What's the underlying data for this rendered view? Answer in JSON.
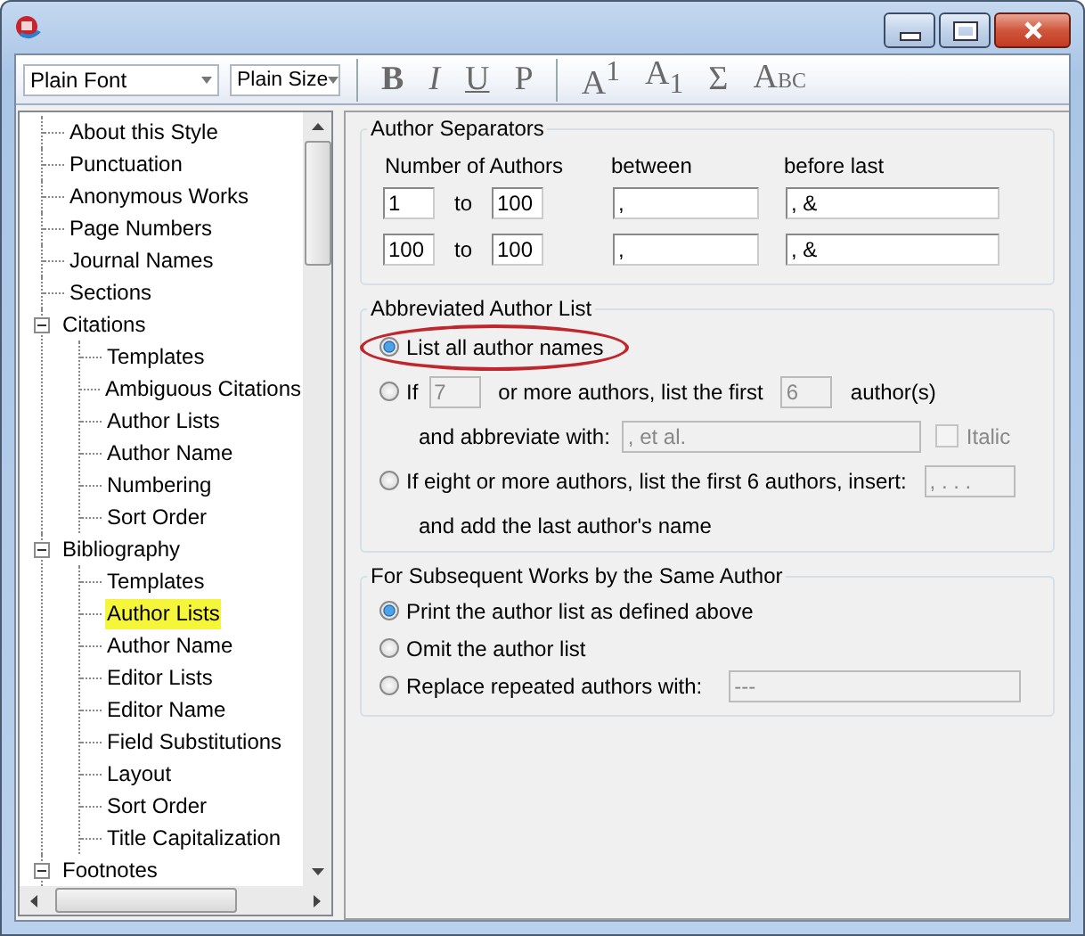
{
  "toolbar": {
    "font_select": "Plain Font",
    "size_select": "Plain Size",
    "format_buttons": [
      {
        "kind": "bold",
        "label": "B"
      },
      {
        "kind": "italic",
        "label": "I"
      },
      {
        "kind": "underline",
        "label": "U"
      },
      {
        "kind": "plain",
        "label": "P"
      }
    ],
    "script_buttons": [
      {
        "kind": "rich",
        "label": "A$^{1}$"
      },
      {
        "kind": "rich",
        "label": "A$_{1}$"
      },
      {
        "kind": "plain",
        "label": "Σ"
      },
      {
        "kind": "smallcaps",
        "label": "A",
        "small": "BC"
      }
    ]
  },
  "tree": [
    {
      "label": "About this Style",
      "selected": false
    },
    {
      "label": "Punctuation",
      "selected": false
    },
    {
      "label": "Anonymous Works",
      "selected": false
    },
    {
      "label": "Page Numbers",
      "selected": false
    },
    {
      "label": "Journal Names",
      "selected": false
    },
    {
      "label": "Sections",
      "selected": false
    },
    {
      "label": "Citations",
      "selected": false,
      "expanded": true,
      "children": [
        {
          "label": "Templates",
          "selected": false
        },
        {
          "label": "Ambiguous Citations",
          "selected": false
        },
        {
          "label": "Author Lists",
          "selected": false
        },
        {
          "label": "Author Name",
          "selected": false
        },
        {
          "label": "Numbering",
          "selected": false
        },
        {
          "label": "Sort Order",
          "selected": false
        }
      ]
    },
    {
      "label": "Bibliography",
      "selected": false,
      "expanded": true,
      "children": [
        {
          "label": "Templates",
          "selected": false
        },
        {
          "label": "Author Lists",
          "selected": true
        },
        {
          "label": "Author Name",
          "selected": false
        },
        {
          "label": "Editor Lists",
          "selected": false
        },
        {
          "label": "Editor Name",
          "selected": false
        },
        {
          "label": "Field Substitutions",
          "selected": false
        },
        {
          "label": "Layout",
          "selected": false
        },
        {
          "label": "Sort Order",
          "selected": false
        },
        {
          "label": "Title Capitalization",
          "selected": false
        }
      ]
    },
    {
      "label": "Footnotes",
      "selected": false,
      "expanded": true
    }
  ],
  "author_separators": {
    "title": "Author Separators",
    "columns": [
      "Number of Authors",
      "between",
      "before last"
    ],
    "rows": [
      {
        "from": "1",
        "to_label": "to",
        "to": "100",
        "between": ",",
        "before_last": ", &"
      },
      {
        "from": "100",
        "to_label": "to",
        "to": "100",
        "between": ",",
        "before_last": ", &"
      }
    ]
  },
  "abbreviated_list": {
    "title": "Abbreviated Author List",
    "options": [
      {
        "kind": "simple",
        "label": "List all author names",
        "selected": true,
        "highlighted": true
      },
      {
        "kind": "threshold",
        "label": "If",
        "selected": false,
        "count": {
          "value": "7",
          "disabled": true
        },
        "middle": "or more authors, list the first",
        "first": {
          "value": "6",
          "disabled": true
        },
        "suffix": "author(s)",
        "abbreviate_label": "and abbreviate with:",
        "abbreviate": {
          "value": ", et al.",
          "disabled": true
        },
        "italic": {
          "label": "Italic",
          "checked": false,
          "disabled": true
        }
      },
      {
        "kind": "insert",
        "label": "If eight or more authors, list the first 6 authors, insert:",
        "selected": false,
        "insert": {
          "value": ", . . .",
          "disabled": true
        },
        "note": "and add the last author's name"
      }
    ]
  },
  "subsequent_works": {
    "title": "For Subsequent Works by the Same Author",
    "options": [
      {
        "kind": "simple",
        "label": "Print the author list as defined above",
        "selected": true
      },
      {
        "kind": "simple",
        "label": "Omit the author list",
        "selected": false
      },
      {
        "kind": "replace",
        "label": "Replace repeated authors with:",
        "selected": false,
        "replace": {
          "value": "---",
          "disabled": true
        }
      }
    ]
  }
}
